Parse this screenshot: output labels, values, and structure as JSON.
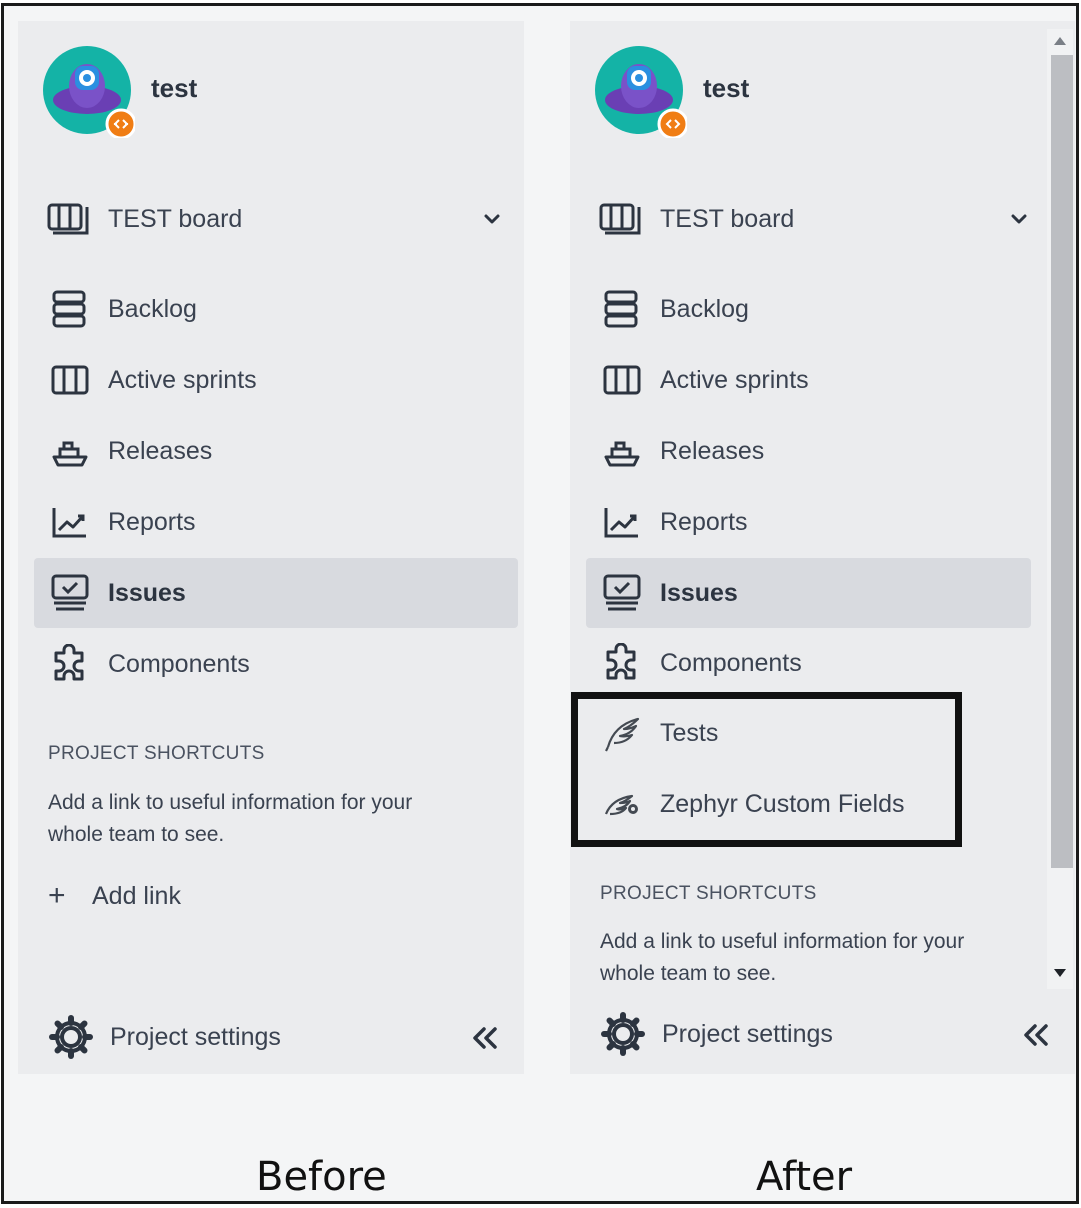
{
  "before": {
    "project_name": "test",
    "board_label": "TEST board",
    "nav": [
      {
        "label": "Backlog",
        "icon": "backlog-icon"
      },
      {
        "label": "Active sprints",
        "icon": "board-columns-icon"
      },
      {
        "label": "Releases",
        "icon": "ship-icon"
      },
      {
        "label": "Reports",
        "icon": "chart-icon"
      },
      {
        "label": "Issues",
        "icon": "issues-icon",
        "selected": true
      },
      {
        "label": "Components",
        "icon": "puzzle-icon"
      }
    ],
    "shortcuts_title": "PROJECT SHORTCUTS",
    "shortcuts_desc": "Add a link to useful information for your whole team to see.",
    "add_link_label": "Add link",
    "settings_label": "Project settings"
  },
  "after": {
    "project_name": "test",
    "board_label": "TEST board",
    "nav": [
      {
        "label": "Backlog",
        "icon": "backlog-icon"
      },
      {
        "label": "Active sprints",
        "icon": "board-columns-icon"
      },
      {
        "label": "Releases",
        "icon": "ship-icon"
      },
      {
        "label": "Reports",
        "icon": "chart-icon"
      },
      {
        "label": "Issues",
        "icon": "issues-icon",
        "selected": true
      },
      {
        "label": "Components",
        "icon": "puzzle-icon"
      },
      {
        "label": "Tests",
        "icon": "zephyr-wing-icon"
      },
      {
        "label": "Zephyr Custom Fields",
        "icon": "zephyr-gear-icon"
      }
    ],
    "shortcuts_title": "PROJECT SHORTCUTS",
    "shortcuts_desc": "Add a link to useful information for your whole team to see.",
    "settings_label": "Project settings"
  },
  "captions": {
    "before": "Before",
    "after": "After"
  },
  "colors": {
    "panel_bg": "#ebecee",
    "selected_bg": "#d8dadf",
    "avatar_teal": "#14b3a6",
    "avatar_purple": "#6a3fb4",
    "avatar_blue": "#2a8fe0",
    "badge_orange": "#f07d14",
    "highlight_border": "#111111"
  }
}
